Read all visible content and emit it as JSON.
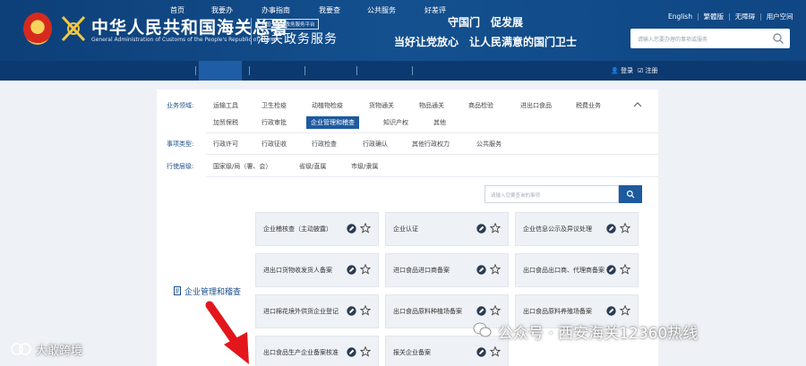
{
  "header": {
    "org_name_cn": "中华人民共和国海关总署",
    "org_name_en": "General Administration of Customs of the People's Republic of China",
    "tag": "全国一体化政务服务平台",
    "portal_name": "海关政务服务",
    "slogan_line1": "守国门　促发展",
    "slogan_line2": "当好让党放心　让人民满意的国门卫士",
    "top_links": [
      "English",
      "繁體版",
      "无障碍",
      "用户空间"
    ],
    "search_placeholder": "请输入您要办理的事项或服务"
  },
  "nav": {
    "items": [
      "首页",
      "我要办",
      "办事指南",
      "我要查",
      "公共服务",
      "好差评"
    ],
    "active": "我要办",
    "login": "登录",
    "register": "注册"
  },
  "filters": {
    "business_area_label": "业务领域:",
    "business_area_row1": [
      "运输工具",
      "卫生检疫",
      "动植物检疫",
      "货物通关",
      "物品通关",
      "商品检验",
      "进出口食品",
      "税费业务"
    ],
    "business_area_row2": [
      "加贸保税",
      "行政审批",
      "企业管理和稽查",
      "知识产权",
      "其他"
    ],
    "business_area_selected": "企业管理和稽查",
    "item_type_label": "事项类型:",
    "item_types": [
      "行政许可",
      "行政征收",
      "行政检查",
      "行政确认",
      "其他行政权力",
      "公共服务"
    ],
    "level_label": "行使层级:",
    "levels": [
      "国家级/局（署、会）",
      "省级/直属",
      "市级/隶属"
    ]
  },
  "inner_search": {
    "placeholder": "请输入您要查询的事项"
  },
  "category": {
    "title": "企业管理和稽查"
  },
  "tiles": [
    "企业稽核查（主动披露）",
    "企业认证",
    "企业信息公示及异议处理",
    "进出口货物收发货人备案",
    "进口食品进口商备案",
    "出口食品出口商、代理商备案",
    "进口棉花境外供货企业登记",
    "出口食品原料种植场备案",
    "出口食品原料养殖场备案",
    "出口食品生产企业备案核准",
    "报关企业备案"
  ],
  "watermarks": {
    "right": "公众号 · 西安海关12360热线",
    "left": "大敢跨境"
  },
  "colors": {
    "header_blue": "#14508f",
    "nav_blue": "#0c3a70",
    "accent_blue": "#1e5aa0",
    "arrow_red": "#e3161b"
  }
}
